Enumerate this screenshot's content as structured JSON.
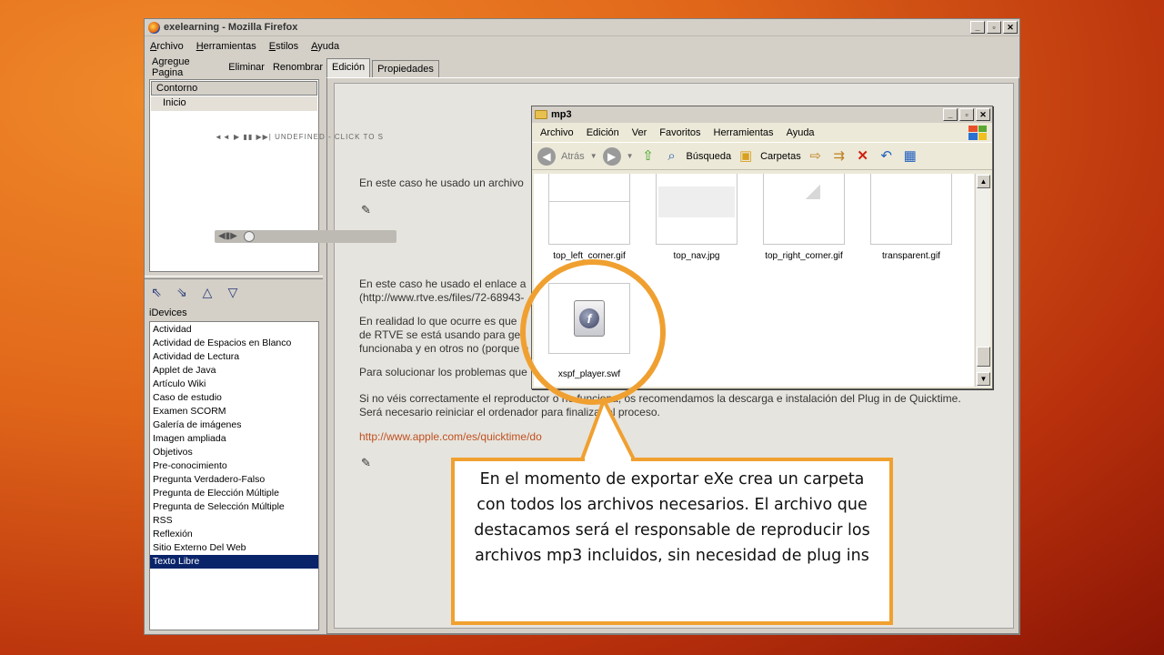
{
  "browser": {
    "title": "exelearning - Mozilla Firefox",
    "menu": [
      "Archivo",
      "Herramientas",
      "Estilos",
      "Ayuda"
    ],
    "controls": [
      "_",
      "▫",
      "✕"
    ]
  },
  "left_pane": {
    "toolbar": [
      "Agregue Pagina",
      "Eliminar",
      "Renombrar"
    ],
    "outline_header": "Contorno",
    "outline_item": "Inicio",
    "idevices_label": "iDevices",
    "idevices": [
      "Actividad",
      "Actividad de Espacios en Blanco",
      "Actividad de Lectura",
      "Applet de Java",
      "Artículo Wiki",
      "Caso de estudio",
      "Examen SCORM",
      "Galería de imágenes",
      "Imagen ampliada",
      "Objetivos",
      "Pre-conocimiento",
      "Pregunta Verdadero-Falso",
      "Pregunta de Elección Múltiple",
      "Pregunta de Selección Múltiple",
      "RSS",
      "Reflexión",
      "Sitio Externo Del Web",
      "Texto Libre"
    ],
    "selected_idevice": "Texto Libre"
  },
  "tabs": [
    "Edición",
    "Propiedades"
  ],
  "document": {
    "player1_label": "◄◄ ▶ ▮▮ ▶▶| UNDEFINED - CLICK TO S",
    "line1": "En este caso he usado un archivo",
    "line2": "En este caso he usado el enlace a",
    "line3": "(http://www.rtve.es/files/72-68943-",
    "line4": "En realidad lo que ocurre es que",
    "line5": "de RTVE se está usando para ges",
    "line6": "funcionaba y en otros no (porque e",
    "line7": "Para solucionar los problemas que",
    "line8": "Si no véis correctamente el reproductor o no funciona, os recomendamos la descarga e instalación del Plug in de Quicktime.",
    "line9": "Será necesario reiniciar el ordenador para finalizar el proceso.",
    "link": "http://www.apple.com/es/quicktime/do"
  },
  "explorer": {
    "title": "mp3",
    "menu": [
      "Archivo",
      "Edición",
      "Ver",
      "Favoritos",
      "Herramientas",
      "Ayuda"
    ],
    "toolbar": {
      "back": "Atrás",
      "search": "Búsqueda",
      "folders": "Carpetas"
    },
    "files": [
      "top_left_corner.gif",
      "top_nav.jpg",
      "top_right_corner.gif",
      "transparent.gif",
      "xspf_player.swf"
    ]
  },
  "callout": {
    "text": "En el momento de exportar eXe crea un carpeta con todos los archivos necesarios. El archivo que destacamos será el responsable de reproducir los archivos mp3 incluidos, sin necesidad de plug ins"
  },
  "colors": {
    "accent": "#f0a030",
    "selection": "#0a246a",
    "link": "#c05020"
  }
}
